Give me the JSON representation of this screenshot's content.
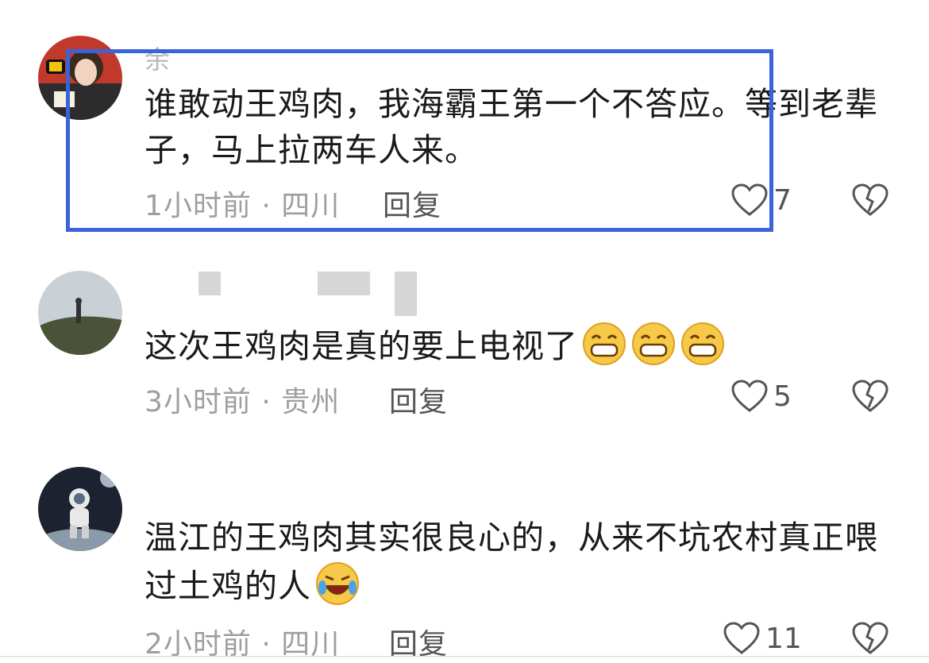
{
  "comments": [
    {
      "username": "余",
      "text": "谁敢动王鸡肉，我海霸王第一个不答应。等到老辈子，马上拉两车人来。",
      "time_location": "1小时前 · 四川",
      "reply_label": "回复",
      "likes": "7",
      "avatar_icon": "avatar-sunglasses-girl",
      "highlighted": true
    },
    {
      "username": "",
      "text": "这次王鸡肉是真的要上电视了",
      "emojis": [
        "grin-emoji",
        "grin-emoji",
        "grin-emoji"
      ],
      "time_location": "3小时前 · 贵州",
      "reply_label": "回复",
      "likes": "5",
      "avatar_icon": "avatar-hill-person"
    },
    {
      "username": "",
      "text": "温江的王鸡肉其实很良心的，从来不坑农村真正喂过土鸡的人",
      "emojis": [
        "laugh-cry-emoji"
      ],
      "time_location": "2小时前 · 四川",
      "reply_label": "回复",
      "likes": "11",
      "avatar_icon": "avatar-astronaut"
    }
  ],
  "colors": {
    "highlight_border": "#3a63d8",
    "meta_gray": "#9e9e9e",
    "text_dark": "#1a1a1a"
  }
}
